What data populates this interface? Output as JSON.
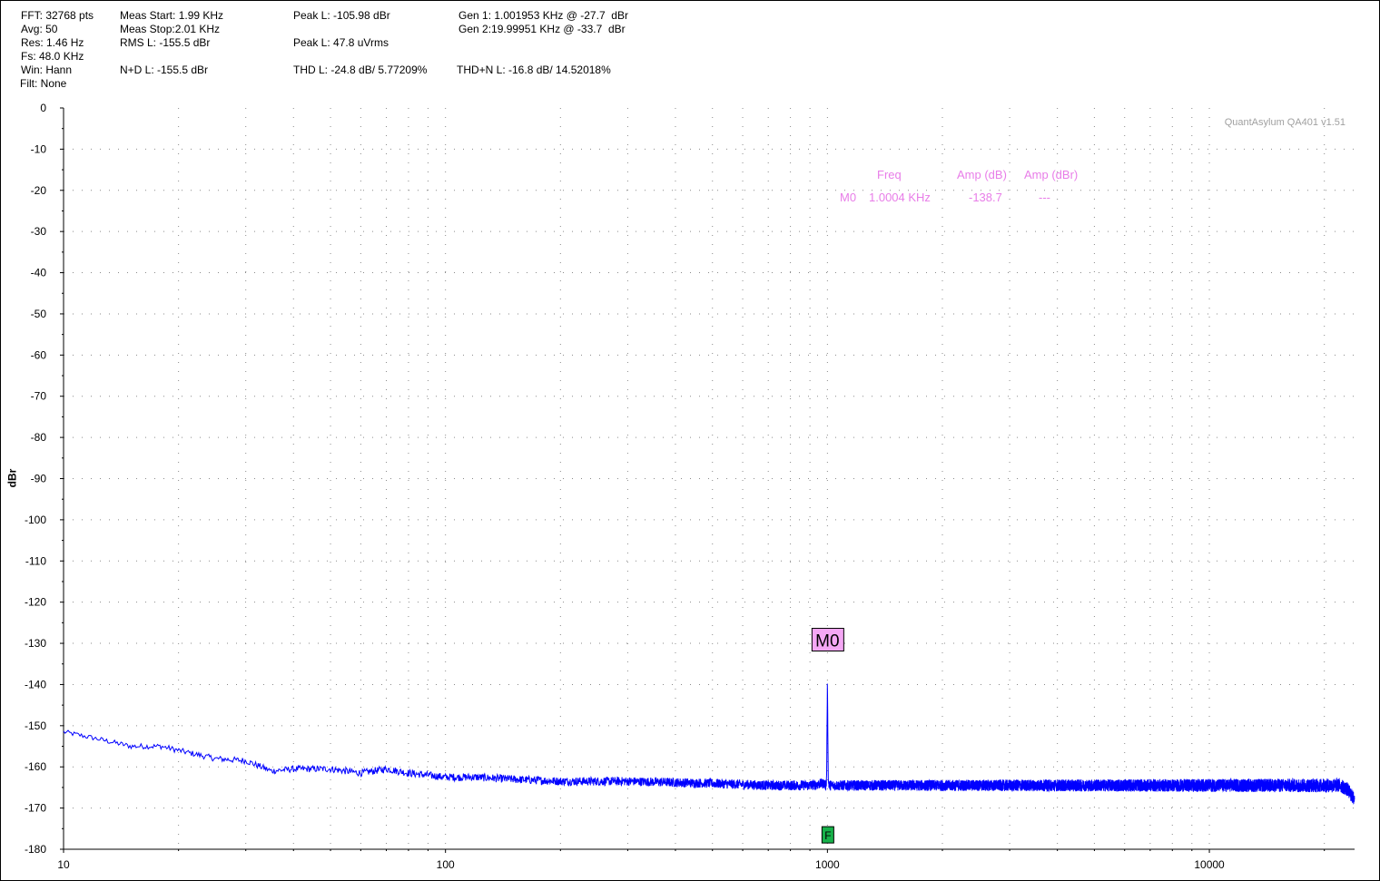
{
  "header": {
    "fft": "FFT: 32768 pts",
    "avg": "Avg: 50",
    "res": "Res: 1.46 Hz",
    "fs": "Fs: 48.0 KHz",
    "win": "Win: Hann",
    "filt": "Filt: None",
    "meas_start": "Meas Start: 1.99 KHz",
    "meas_stop": "Meas Stop:2.01 KHz",
    "rms_l": "RMS L: -155.5 dBr",
    "nd_l": "N+D L: -155.5 dBr",
    "peak_l_dbr": "Peak L: -105.98 dBr",
    "peak_l_urms": "Peak L: 47.8 uVrms",
    "thd_l": "THD L: -24.8 dB/ 5.77209%",
    "gen1": "Gen 1: 1.001953 KHz @ -27.7  dBr",
    "gen2": "Gen 2:19.99951 KHz @ -33.7  dBr",
    "thdn_l": "THD+N L: -16.8 dB/ 14.52018%"
  },
  "watermark": "QuantAsylum QA401 v1.51",
  "marker_table": {
    "col_freq": "Freq",
    "col_amp_db": "Amp (dB)",
    "col_amp_dbr": "Amp (dBr)",
    "marker": "M0",
    "freq": "1.0004 KHz",
    "amp_db": "-138.7",
    "amp_dbr": "---",
    "color": "#e87de8"
  },
  "chart_data": {
    "type": "line",
    "xscale": "log",
    "xlim": [
      10,
      24000
    ],
    "ylim": [
      -180,
      0
    ],
    "ylabel": "dBr",
    "xlabel": "",
    "x_ticks": [
      "10",
      "100",
      "1000",
      "10000"
    ],
    "y_ticks": [
      "0",
      "-10",
      "-20",
      "-30",
      "-40",
      "-50",
      "-60",
      "-70",
      "-80",
      "-90",
      "-100",
      "-110",
      "-120",
      "-130",
      "-140",
      "-150",
      "-160",
      "-170",
      "-180"
    ],
    "grid": true,
    "series": [
      {
        "color": "#0000ff",
        "x": [
          10,
          12,
          15,
          18,
          20,
          25,
          30,
          35,
          40,
          50,
          60,
          70,
          80,
          100,
          120,
          150,
          200,
          300,
          500,
          700,
          900,
          980,
          990,
          995,
          1000,
          1005,
          1010,
          1020,
          1100,
          1500,
          2000,
          3000,
          5000,
          7000,
          10000,
          15000,
          20000,
          22000,
          23000,
          24000
        ],
        "y": [
          -151.5,
          -153,
          -155,
          -155,
          -156,
          -158,
          -158.5,
          -161,
          -160.5,
          -160.5,
          -161.5,
          -160.5,
          -161.5,
          -162.5,
          -162.5,
          -163,
          -163.5,
          -163.5,
          -164,
          -164.5,
          -164.5,
          -164,
          -164.5,
          -163,
          -139,
          -163,
          -164.5,
          -164.5,
          -164.5,
          -164.5,
          -164.5,
          -164.5,
          -164.5,
          -164.5,
          -164.5,
          -164.5,
          -164.5,
          -164.5,
          -165.5,
          -168
        ]
      }
    ],
    "markers": [
      {
        "label": "M0",
        "x": 1000,
        "y": -129,
        "fill": "#f4a7f4"
      },
      {
        "label": "F",
        "x": 1000,
        "y": -176.5,
        "fill": "#17b24a"
      }
    ]
  }
}
